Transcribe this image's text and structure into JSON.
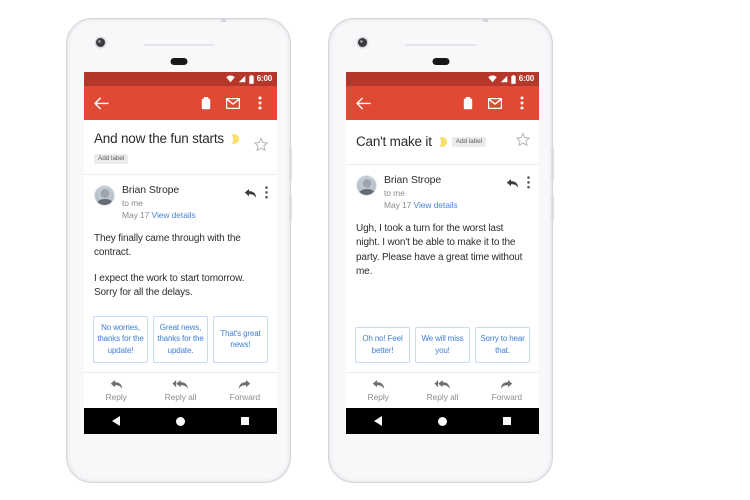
{
  "theme": {
    "statusbar_color": "#b5372c",
    "appbar_color": "#e04a35",
    "chip_text_color": "#3f7fd4",
    "chip_border_color": "#c8daf4",
    "link_color": "#4a86d8",
    "navbar_color": "#000000",
    "page_background": "#ffffff"
  },
  "phones": [
    {
      "id": "phone-left",
      "status_bar": {
        "time": "6:00",
        "icons": [
          "wifi-icon",
          "signal-icon",
          "battery-icon"
        ]
      },
      "app_bar": {
        "back_label": "Back",
        "actions": [
          "delete-icon",
          "mark-unread-icon",
          "overflow-menu-icon"
        ]
      },
      "subject": {
        "text": "And now the fun starts",
        "emoji": "moon-emoji",
        "add_label": "Add label",
        "label_position": "below",
        "star": "star-outline-icon"
      },
      "message": {
        "sender": "Brian Strope",
        "recipient": "to me",
        "date": "May 17",
        "details_link": "View details",
        "reply_icon": "reply-arrow-icon",
        "overflow_icon": "overflow-menu-icon",
        "paragraphs": [
          "They finally came through with the contract.",
          "I expect the work to start tomorrow. Sorry for all the delays."
        ]
      },
      "smart_replies": [
        "No worries, thanks for the update!",
        "Great news, thanks for the update.",
        "That's great news!"
      ],
      "reply_bar": [
        {
          "label": "Reply",
          "icon": "reply-icon"
        },
        {
          "label": "Reply all",
          "icon": "reply-all-icon"
        },
        {
          "label": "Forward",
          "icon": "forward-icon"
        }
      ],
      "nav_bar": [
        {
          "name": "back-button",
          "icon": "triangle-icon"
        },
        {
          "name": "home-button",
          "icon": "circle-icon"
        },
        {
          "name": "recents-button",
          "icon": "square-icon"
        }
      ]
    },
    {
      "id": "phone-right",
      "status_bar": {
        "time": "6:00",
        "icons": [
          "wifi-icon",
          "signal-icon",
          "battery-icon"
        ]
      },
      "app_bar": {
        "back_label": "Back",
        "actions": [
          "delete-icon",
          "mark-unread-icon",
          "overflow-menu-icon"
        ]
      },
      "subject": {
        "text": "Can't make it",
        "emoji": "moon-emoji",
        "add_label": "Add label",
        "label_position": "inline",
        "star": "star-outline-icon"
      },
      "message": {
        "sender": "Brian Strope",
        "recipient": "to me",
        "date": "May 17",
        "details_link": "View details",
        "reply_icon": "reply-arrow-icon",
        "overflow_icon": "overflow-menu-icon",
        "paragraphs": [
          "Ugh, I took a turn for the worst last night. I won't be able to make it to the party. Please have a great time without me."
        ]
      },
      "smart_replies": [
        "Oh no! Feel better!",
        "We will miss you!",
        "Sorry to hear that."
      ],
      "reply_bar": [
        {
          "label": "Reply",
          "icon": "reply-icon"
        },
        {
          "label": "Reply all",
          "icon": "reply-all-icon"
        },
        {
          "label": "Forward",
          "icon": "forward-icon"
        }
      ],
      "nav_bar": [
        {
          "name": "back-button",
          "icon": "triangle-icon"
        },
        {
          "name": "home-button",
          "icon": "circle-icon"
        },
        {
          "name": "recents-button",
          "icon": "square-icon"
        }
      ]
    }
  ]
}
